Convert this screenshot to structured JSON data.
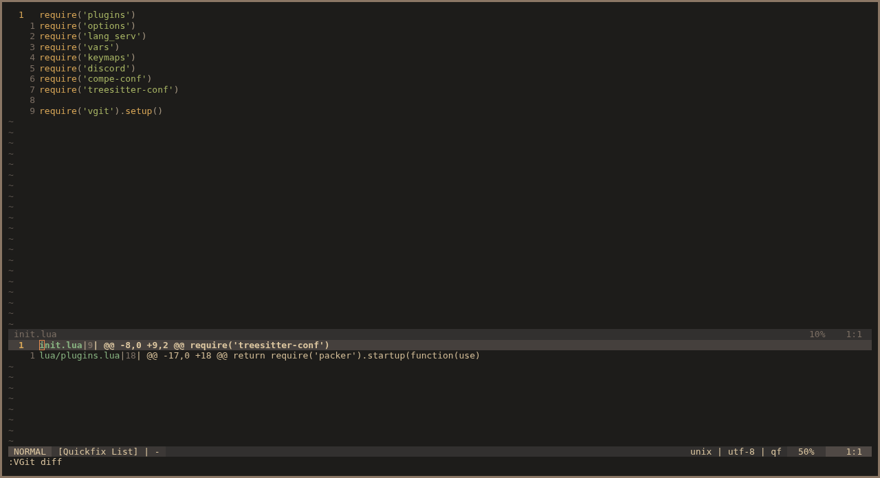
{
  "editor": {
    "lines": [
      {
        "number": "1",
        "current": true,
        "tokens": [
          {
            "text": "require",
            "kind": "func"
          },
          {
            "text": "(",
            "kind": "punct"
          },
          {
            "text": "'plugins'",
            "kind": "string"
          },
          {
            "text": ")",
            "kind": "punct"
          }
        ]
      },
      {
        "number": "1",
        "current": false,
        "tokens": [
          {
            "text": "require",
            "kind": "func"
          },
          {
            "text": "(",
            "kind": "punct"
          },
          {
            "text": "'options'",
            "kind": "string"
          },
          {
            "text": ")",
            "kind": "punct"
          }
        ]
      },
      {
        "number": "2",
        "current": false,
        "tokens": [
          {
            "text": "require",
            "kind": "func"
          },
          {
            "text": "(",
            "kind": "punct"
          },
          {
            "text": "'lang_serv'",
            "kind": "string"
          },
          {
            "text": ")",
            "kind": "punct"
          }
        ]
      },
      {
        "number": "3",
        "current": false,
        "tokens": [
          {
            "text": "require",
            "kind": "func"
          },
          {
            "text": "(",
            "kind": "punct"
          },
          {
            "text": "'vars'",
            "kind": "string"
          },
          {
            "text": ")",
            "kind": "punct"
          }
        ]
      },
      {
        "number": "4",
        "current": false,
        "tokens": [
          {
            "text": "require",
            "kind": "func"
          },
          {
            "text": "(",
            "kind": "punct"
          },
          {
            "text": "'keymaps'",
            "kind": "string"
          },
          {
            "text": ")",
            "kind": "punct"
          }
        ]
      },
      {
        "number": "5",
        "current": false,
        "tokens": [
          {
            "text": "require",
            "kind": "func"
          },
          {
            "text": "(",
            "kind": "punct"
          },
          {
            "text": "'discord'",
            "kind": "string"
          },
          {
            "text": ")",
            "kind": "punct"
          }
        ]
      },
      {
        "number": "6",
        "current": false,
        "tokens": [
          {
            "text": "require",
            "kind": "func"
          },
          {
            "text": "(",
            "kind": "punct"
          },
          {
            "text": "'compe-conf'",
            "kind": "string"
          },
          {
            "text": ")",
            "kind": "punct"
          }
        ]
      },
      {
        "number": "7",
        "current": false,
        "tokens": [
          {
            "text": "require",
            "kind": "func"
          },
          {
            "text": "(",
            "kind": "punct"
          },
          {
            "text": "'treesitter-conf'",
            "kind": "string"
          },
          {
            "text": ")",
            "kind": "punct"
          }
        ]
      },
      {
        "number": "8",
        "current": false
      },
      {
        "number": "9",
        "current": false,
        "tokens": [
          {
            "text": "require",
            "kind": "func"
          },
          {
            "text": "(",
            "kind": "punct"
          },
          {
            "text": "'vgit'",
            "kind": "string"
          },
          {
            "text": ").",
            "kind": "punct"
          },
          {
            "text": "setup",
            "kind": "func"
          },
          {
            "text": "()",
            "kind": "punct"
          }
        ]
      }
    ],
    "filler": [
      "~",
      "~",
      "~",
      "~",
      "~",
      "~",
      "~",
      "~",
      "~",
      "~",
      "~",
      "~",
      "~",
      "~",
      "~",
      "~",
      "~",
      "~",
      "~",
      "~"
    ],
    "status": {
      "file": "init.lua",
      "percent": "10%",
      "position": "1:1"
    }
  },
  "quickfix": {
    "rows": [
      {
        "number": "1",
        "selected": true,
        "cursor": true,
        "file": "init.lua",
        "sep1": "|",
        "lnum": "9",
        "sep2": "|",
        "text": " @@ -8,0 +9,2 @@ require('treesitter-conf')"
      },
      {
        "number": "1",
        "selected": false,
        "cursor": false,
        "file": "lua/plugins.lua",
        "sep1": "|",
        "lnum": "18",
        "sep2": "|",
        "text": " @@ -17,0 +18 @@ return require('packer').startup(function(use)"
      }
    ],
    "filler": [
      "~",
      "~",
      "~",
      "~",
      "~",
      "~",
      "~",
      "~"
    ],
    "status": {
      "mode": "NORMAL",
      "name": "[Quickfix List] | -",
      "info": "unix | utf-8 | qf",
      "percent": "50%",
      "position": "1:1"
    }
  },
  "command_line": ":VGit diff"
}
